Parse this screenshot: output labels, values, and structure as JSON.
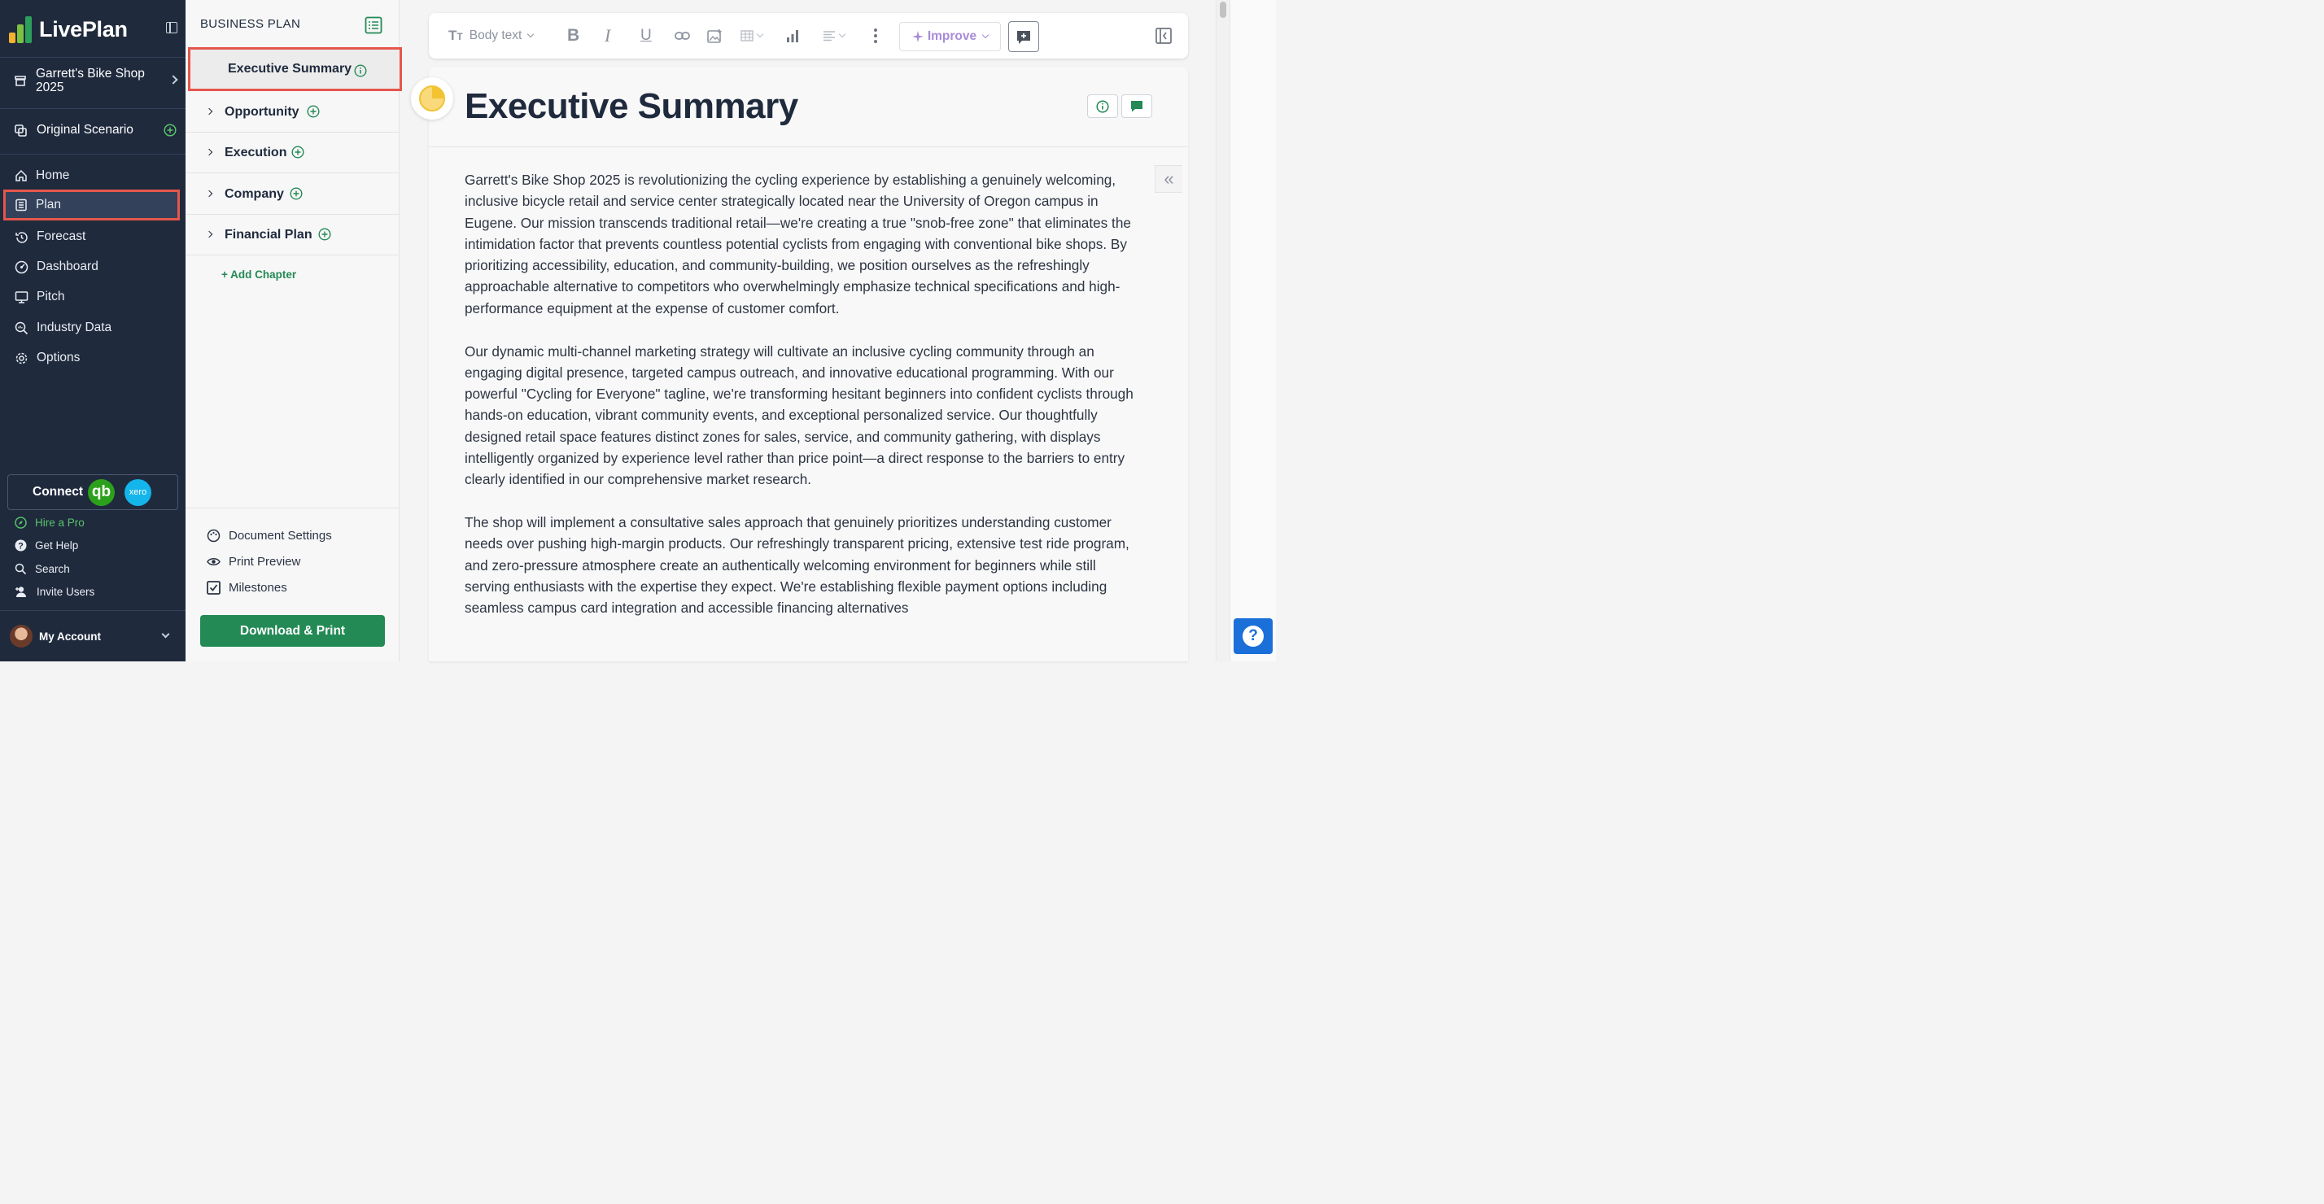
{
  "app": {
    "name": "LivePlan"
  },
  "nav": {
    "company": "Garrett's Bike Shop 2025",
    "scenario": "Original Scenario",
    "items": [
      {
        "label": "Home",
        "icon": "home-icon"
      },
      {
        "label": "Plan",
        "icon": "plan-icon",
        "active": true
      },
      {
        "label": "Forecast",
        "icon": "forecast-icon"
      },
      {
        "label": "Dashboard",
        "icon": "dashboard-icon"
      },
      {
        "label": "Pitch",
        "icon": "pitch-icon"
      },
      {
        "label": "Industry Data",
        "icon": "industry-data-icon"
      },
      {
        "label": "Options",
        "icon": "gear-icon"
      }
    ],
    "connect": {
      "label": "Connect",
      "quickbooks": "qb",
      "xero": "xero"
    },
    "utilities": [
      {
        "label": "Hire a Pro",
        "icon": "compass-icon"
      },
      {
        "label": "Get Help",
        "icon": "help-icon"
      },
      {
        "label": "Search",
        "icon": "search-icon"
      },
      {
        "label": "Invite Users",
        "icon": "add-user-icon"
      }
    ],
    "account": "My Account"
  },
  "outline": {
    "title": "BUSINESS PLAN",
    "chapters": [
      {
        "label": "Executive Summary",
        "active": true
      },
      {
        "label": "Opportunity"
      },
      {
        "label": "Execution"
      },
      {
        "label": "Company"
      },
      {
        "label": "Financial Plan"
      }
    ],
    "add_chapter": "+ Add Chapter",
    "footer": [
      {
        "label": "Document Settings",
        "icon": "palette-icon"
      },
      {
        "label": "Print Preview",
        "icon": "eye-icon"
      },
      {
        "label": "Milestones",
        "icon": "checkbox-icon"
      }
    ],
    "download": "Download & Print"
  },
  "toolbar": {
    "text_style": "Body text",
    "improve": "Improve"
  },
  "document": {
    "title": "Executive Summary",
    "paragraphs": [
      "Garrett's Bike Shop 2025 is revolutionizing the cycling experience by establishing a genuinely welcoming, inclusive bicycle retail and service center strategically located near the University of Oregon campus in Eugene. Our mission transcends traditional retail—we're creating a true \"snob-free zone\" that eliminates the intimidation factor that prevents countless potential cyclists from engaging with conventional bike shops. By prioritizing accessibility, education, and community-building, we position ourselves as the refreshingly approachable alternative to competitors who overwhelmingly emphasize technical specifications and high-performance equipment at the expense of customer comfort.",
      "Our dynamic multi-channel marketing strategy will cultivate an inclusive cycling community through an engaging digital presence, targeted campus outreach, and innovative educational programming. With our powerful \"Cycling for Everyone\" tagline, we're transforming hesitant beginners into confident cyclists through hands-on education, vibrant community events, and exceptional personalized service. Our thoughtfully designed retail space features distinct zones for sales, service, and community gathering, with displays intelligently organized by experience level rather than price point—a direct response to the barriers to entry clearly identified in our comprehensive market research.",
      "The shop will implement a consultative sales approach that genuinely prioritizes understanding customer needs over pushing high-margin products. Our refreshingly transparent pricing, extensive test ride program, and zero-pressure atmosphere create an authentically welcoming environment for beginners while still serving enthusiasts with the expertise they expect. We're establishing flexible payment options including seamless campus card integration and accessible financing alternatives"
    ]
  },
  "colors": {
    "nav_bg": "#1f2a3d",
    "accent_green": "#238a55",
    "highlight_red": "#e5564b",
    "improve_purple": "#a78bd8",
    "help_blue": "#1b6fd8"
  }
}
